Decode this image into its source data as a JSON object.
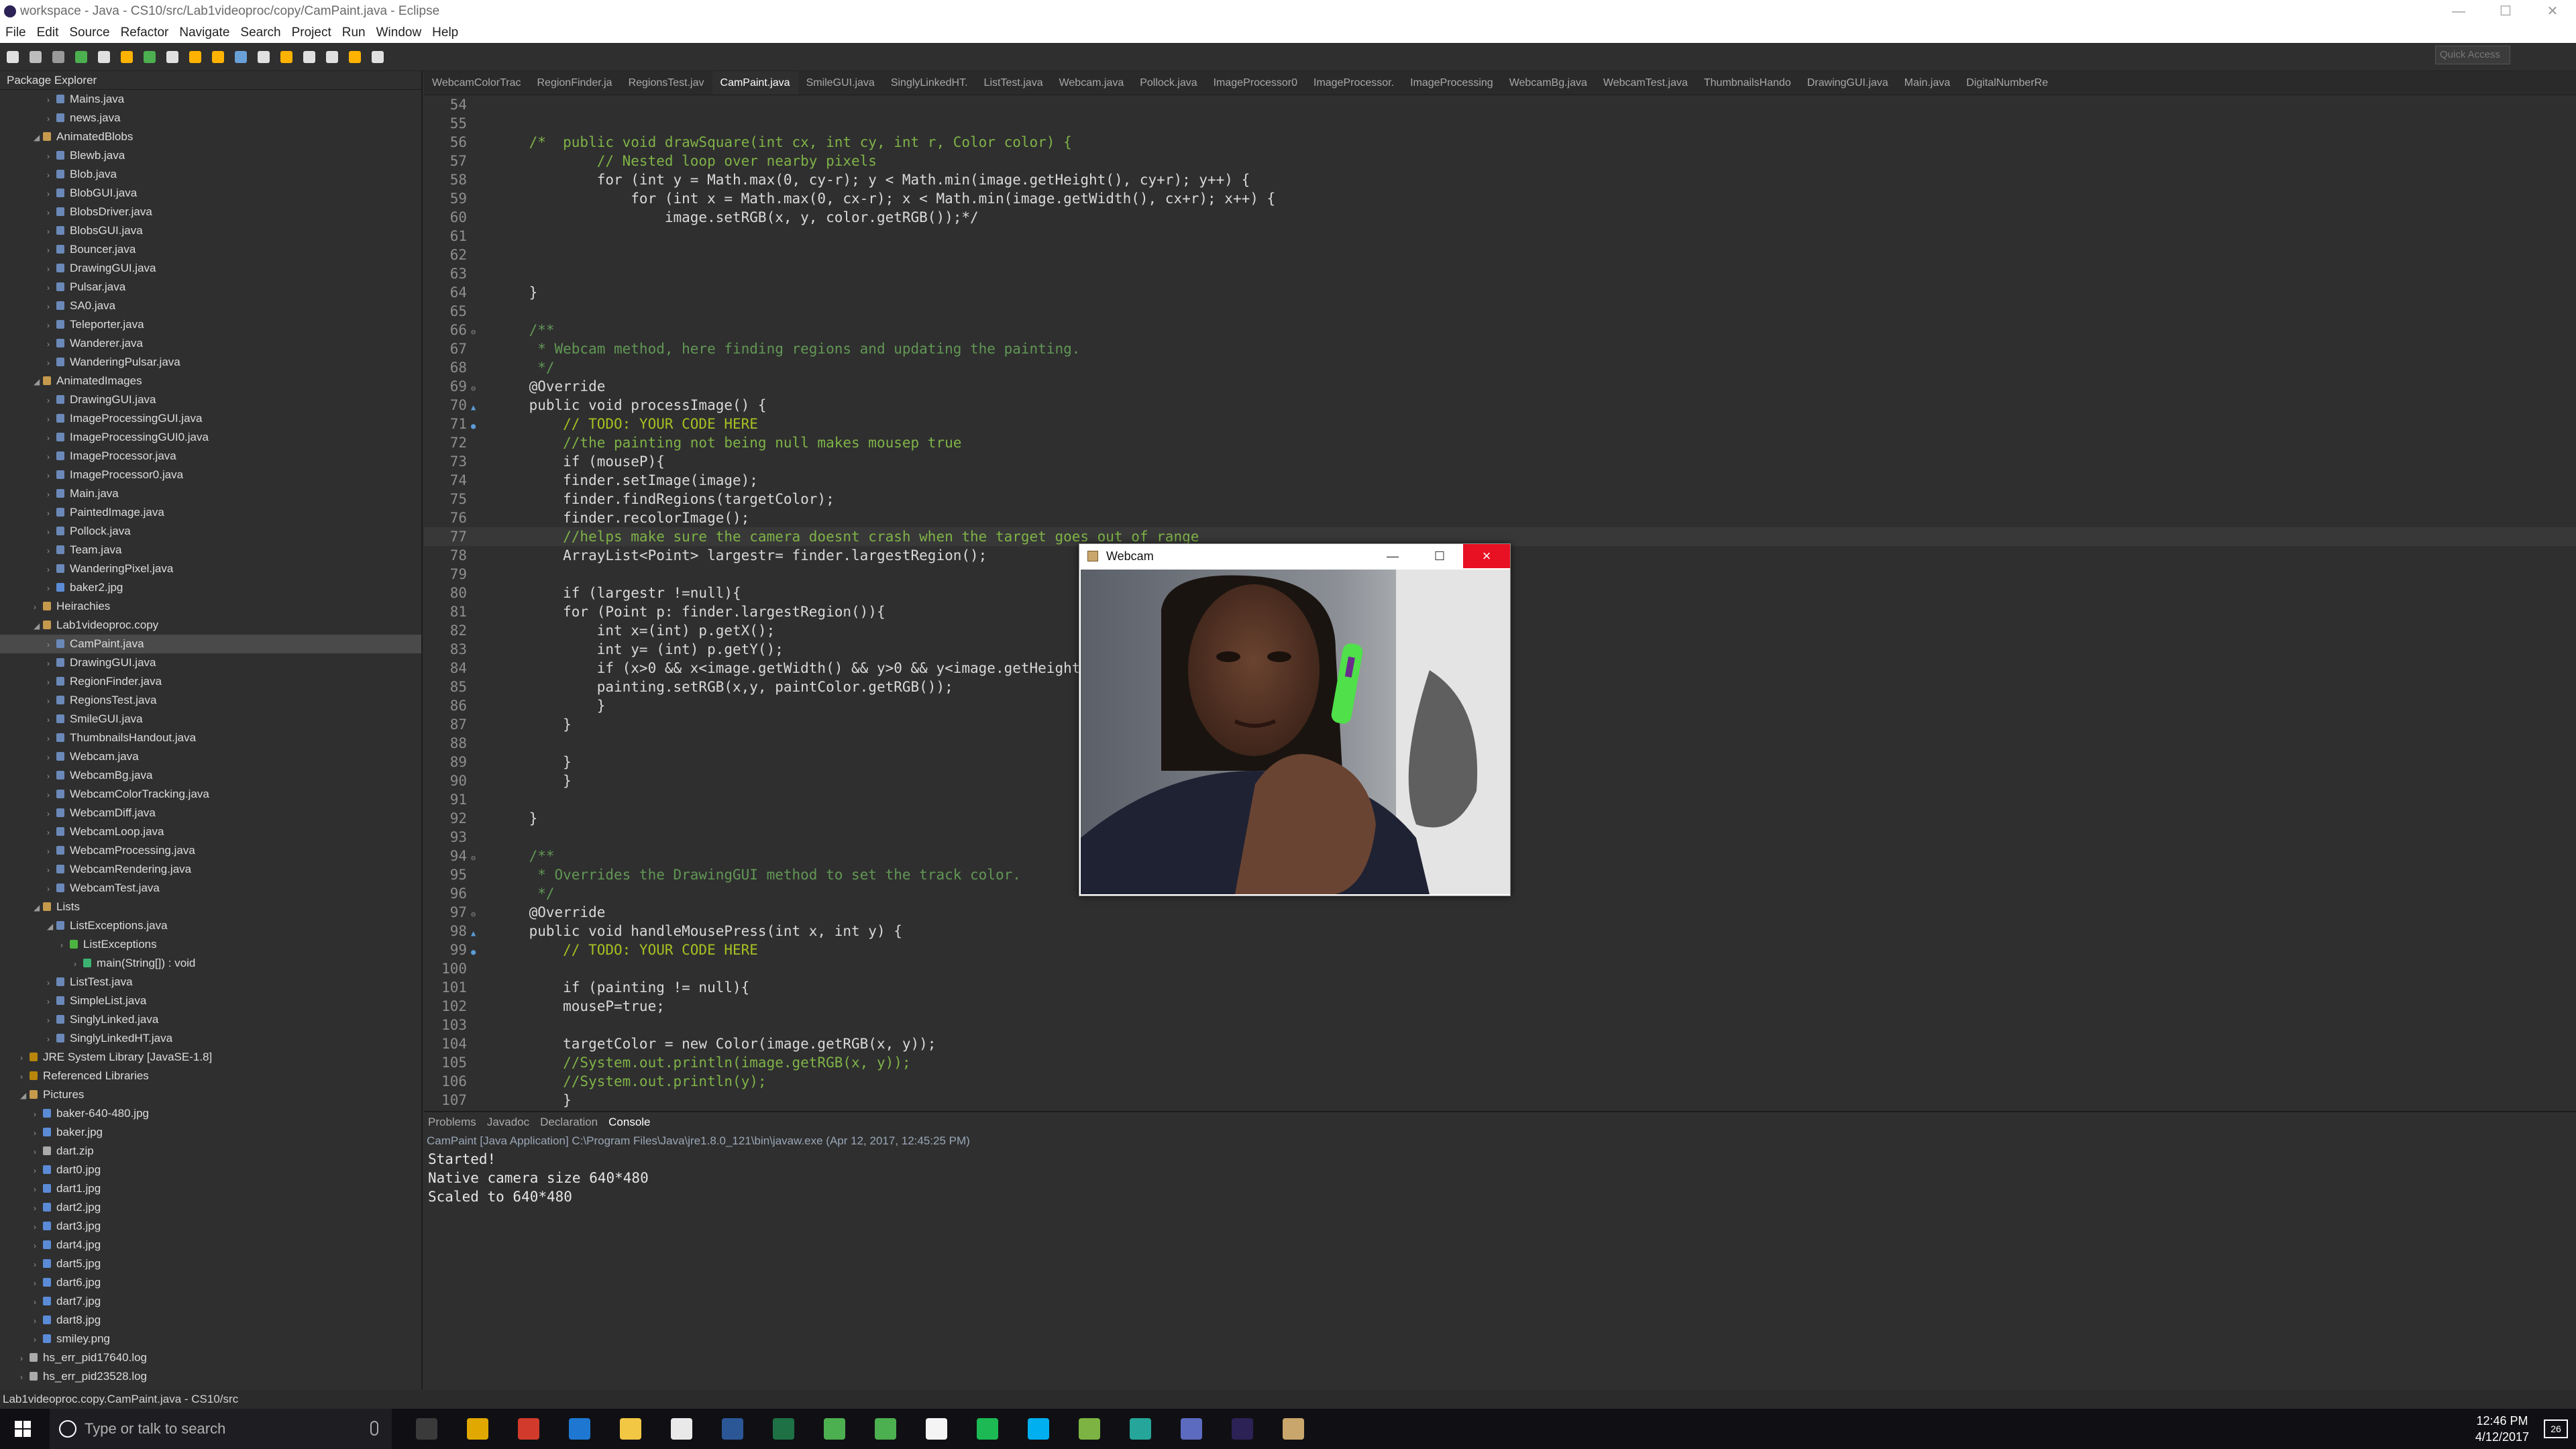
{
  "window": {
    "title": "workspace - Java - CS10/src/Lab1videoproc/copy/CamPaint.java - Eclipse"
  },
  "menu": [
    "File",
    "Edit",
    "Source",
    "Refactor",
    "Navigate",
    "Search",
    "Project",
    "Run",
    "Window",
    "Help"
  ],
  "quick_access": {
    "placeholder": "Quick Access"
  },
  "package_explorer": {
    "title": "Package Explorer",
    "items": [
      {
        "label": "Mains.java",
        "indent": 3,
        "kind": "java"
      },
      {
        "label": "news.java",
        "indent": 3,
        "kind": "java"
      },
      {
        "label": "AnimatedBlobs",
        "indent": 2,
        "kind": "pkg",
        "open": true
      },
      {
        "label": "Blewb.java",
        "indent": 3,
        "kind": "java"
      },
      {
        "label": "Blob.java",
        "indent": 3,
        "kind": "java"
      },
      {
        "label": "BlobGUI.java",
        "indent": 3,
        "kind": "java"
      },
      {
        "label": "BlobsDriver.java",
        "indent": 3,
        "kind": "java"
      },
      {
        "label": "BlobsGUI.java",
        "indent": 3,
        "kind": "java"
      },
      {
        "label": "Bouncer.java",
        "indent": 3,
        "kind": "java"
      },
      {
        "label": "DrawingGUI.java",
        "indent": 3,
        "kind": "java"
      },
      {
        "label": "Pulsar.java",
        "indent": 3,
        "kind": "java"
      },
      {
        "label": "SA0.java",
        "indent": 3,
        "kind": "java"
      },
      {
        "label": "Teleporter.java",
        "indent": 3,
        "kind": "java"
      },
      {
        "label": "Wanderer.java",
        "indent": 3,
        "kind": "java"
      },
      {
        "label": "WanderingPulsar.java",
        "indent": 3,
        "kind": "java"
      },
      {
        "label": "AnimatedImages",
        "indent": 2,
        "kind": "pkg",
        "open": true
      },
      {
        "label": "DrawingGUI.java",
        "indent": 3,
        "kind": "java"
      },
      {
        "label": "ImageProcessingGUI.java",
        "indent": 3,
        "kind": "java"
      },
      {
        "label": "ImageProcessingGUI0.java",
        "indent": 3,
        "kind": "java"
      },
      {
        "label": "ImageProcessor.java",
        "indent": 3,
        "kind": "java"
      },
      {
        "label": "ImageProcessor0.java",
        "indent": 3,
        "kind": "java"
      },
      {
        "label": "Main.java",
        "indent": 3,
        "kind": "java"
      },
      {
        "label": "PaintedImage.java",
        "indent": 3,
        "kind": "java"
      },
      {
        "label": "Pollock.java",
        "indent": 3,
        "kind": "java"
      },
      {
        "label": "Team.java",
        "indent": 3,
        "kind": "java"
      },
      {
        "label": "WanderingPixel.java",
        "indent": 3,
        "kind": "java"
      },
      {
        "label": "baker2.jpg",
        "indent": 3,
        "kind": "img"
      },
      {
        "label": "Heirachies",
        "indent": 2,
        "kind": "pkg-empty"
      },
      {
        "label": "Lab1videoproc.copy",
        "indent": 2,
        "kind": "pkg",
        "open": true
      },
      {
        "label": "CamPaint.java",
        "indent": 3,
        "kind": "java",
        "selected": true
      },
      {
        "label": "DrawingGUI.java",
        "indent": 3,
        "kind": "java"
      },
      {
        "label": "RegionFinder.java",
        "indent": 3,
        "kind": "java"
      },
      {
        "label": "RegionsTest.java",
        "indent": 3,
        "kind": "java"
      },
      {
        "label": "SmileGUI.java",
        "indent": 3,
        "kind": "java"
      },
      {
        "label": "ThumbnailsHandout.java",
        "indent": 3,
        "kind": "java"
      },
      {
        "label": "Webcam.java",
        "indent": 3,
        "kind": "java"
      },
      {
        "label": "WebcamBg.java",
        "indent": 3,
        "kind": "java"
      },
      {
        "label": "WebcamColorTracking.java",
        "indent": 3,
        "kind": "java"
      },
      {
        "label": "WebcamDiff.java",
        "indent": 3,
        "kind": "java"
      },
      {
        "label": "WebcamLoop.java",
        "indent": 3,
        "kind": "java"
      },
      {
        "label": "WebcamProcessing.java",
        "indent": 3,
        "kind": "java"
      },
      {
        "label": "WebcamRendering.java",
        "indent": 3,
        "kind": "java"
      },
      {
        "label": "WebcamTest.java",
        "indent": 3,
        "kind": "java"
      },
      {
        "label": "Lists",
        "indent": 2,
        "kind": "pkg",
        "open": true
      },
      {
        "label": "ListExceptions.java",
        "indent": 3,
        "kind": "java",
        "open": true
      },
      {
        "label": "ListExceptions",
        "indent": 4,
        "kind": "class"
      },
      {
        "label": "main(String[]) : void",
        "indent": 5,
        "kind": "method"
      },
      {
        "label": "ListTest.java",
        "indent": 3,
        "kind": "java"
      },
      {
        "label": "SimpleList.java",
        "indent": 3,
        "kind": "java"
      },
      {
        "label": "SinglyLinked.java",
        "indent": 3,
        "kind": "java"
      },
      {
        "label": "SinglyLinkedHT.java",
        "indent": 3,
        "kind": "java"
      },
      {
        "label": "JRE System Library [JavaSE-1.8]",
        "indent": 1,
        "kind": "lib"
      },
      {
        "label": "Referenced Libraries",
        "indent": 1,
        "kind": "lib"
      },
      {
        "label": "Pictures",
        "indent": 1,
        "kind": "folder",
        "open": true
      },
      {
        "label": "baker-640-480.jpg",
        "indent": 2,
        "kind": "img"
      },
      {
        "label": "baker.jpg",
        "indent": 2,
        "kind": "img"
      },
      {
        "label": "dart.zip",
        "indent": 2,
        "kind": "file"
      },
      {
        "label": "dart0.jpg",
        "indent": 2,
        "kind": "img"
      },
      {
        "label": "dart1.jpg",
        "indent": 2,
        "kind": "img"
      },
      {
        "label": "dart2.jpg",
        "indent": 2,
        "kind": "img"
      },
      {
        "label": "dart3.jpg",
        "indent": 2,
        "kind": "img"
      },
      {
        "label": "dart4.jpg",
        "indent": 2,
        "kind": "img"
      },
      {
        "label": "dart5.jpg",
        "indent": 2,
        "kind": "img"
      },
      {
        "label": "dart6.jpg",
        "indent": 2,
        "kind": "img"
      },
      {
        "label": "dart7.jpg",
        "indent": 2,
        "kind": "img"
      },
      {
        "label": "dart8.jpg",
        "indent": 2,
        "kind": "img"
      },
      {
        "label": "smiley.png",
        "indent": 2,
        "kind": "img"
      },
      {
        "label": "hs_err_pid17640.log",
        "indent": 1,
        "kind": "file"
      },
      {
        "label": "hs_err_pid23528.log",
        "indent": 1,
        "kind": "file"
      }
    ]
  },
  "editor_tabs": [
    {
      "label": "WebcamColorTrac"
    },
    {
      "label": "RegionFinder.ja"
    },
    {
      "label": "RegionsTest.jav"
    },
    {
      "label": "CamPaint.java",
      "active": true
    },
    {
      "label": "SmileGUI.java"
    },
    {
      "label": "SinglyLinkedHT."
    },
    {
      "label": "ListTest.java"
    },
    {
      "label": "Webcam.java"
    },
    {
      "label": "Pollock.java"
    },
    {
      "label": "ImageProcessor0"
    },
    {
      "label": "ImageProcessor."
    },
    {
      "label": "ImageProcessing"
    },
    {
      "label": "WebcamBg.java"
    },
    {
      "label": "WebcamTest.java"
    },
    {
      "label": "ThumbnailsHando"
    },
    {
      "label": "DrawingGUI.java"
    },
    {
      "label": "Main.java"
    },
    {
      "label": "DigitalNumberRe"
    }
  ],
  "code": [
    {
      "n": "54",
      "t": ""
    },
    {
      "n": "55",
      "t": ""
    },
    {
      "n": "56",
      "t": "    /*  public void drawSquare(int cx, int cy, int r, Color color) {"
    },
    {
      "n": "57",
      "t": "            // Nested loop over nearby pixels"
    },
    {
      "n": "58",
      "t": "            for (int y = Math.max(0, cy-r); y < Math.min(image.getHeight(), cy+r); y++) {"
    },
    {
      "n": "59",
      "t": "                for (int x = Math.max(0, cx-r); x < Math.min(image.getWidth(), cx+r); x++) {"
    },
    {
      "n": "60",
      "t": "                    image.setRGB(x, y, color.getRGB());*/"
    },
    {
      "n": "61",
      "t": ""
    },
    {
      "n": "62",
      "t": ""
    },
    {
      "n": "63",
      "t": ""
    },
    {
      "n": "64",
      "t": "    }"
    },
    {
      "n": "65",
      "t": ""
    },
    {
      "n": "66",
      "t": "    /**",
      "mark": "fold"
    },
    {
      "n": "67",
      "t": "     * Webcam method, here finding regions and updating the painting."
    },
    {
      "n": "68",
      "t": "     */"
    },
    {
      "n": "69",
      "t": "    @Override",
      "mark": "fold"
    },
    {
      "n": "70",
      "t": "    public void processImage() {",
      "mark": "override"
    },
    {
      "n": "71",
      "t": "        // TODO: YOUR CODE HERE",
      "mark": "task"
    },
    {
      "n": "72",
      "t": "        //the painting not being null makes mousep true"
    },
    {
      "n": "73",
      "t": "        if (mouseP){"
    },
    {
      "n": "74",
      "t": "        finder.setImage(image);"
    },
    {
      "n": "75",
      "t": "        finder.findRegions(targetColor);"
    },
    {
      "n": "76",
      "t": "        finder.recolorImage();"
    },
    {
      "n": "77",
      "t": "        //helps make sure the camera doesnt crash when the target goes out of range",
      "hl": true
    },
    {
      "n": "78",
      "t": "        ArrayList<Point> largestr= finder.largestRegion();"
    },
    {
      "n": "79",
      "t": ""
    },
    {
      "n": "80",
      "t": "        if (largestr !=null){"
    },
    {
      "n": "81",
      "t": "        for (Point p: finder.largestRegion()){"
    },
    {
      "n": "82",
      "t": "            int x=(int) p.getX();"
    },
    {
      "n": "83",
      "t": "            int y= (int) p.getY();"
    },
    {
      "n": "84",
      "t": "            if (x>0 && x<image.getWidth() && y>0 && y<image.getHeight("
    },
    {
      "n": "85",
      "t": "            painting.setRGB(x,y, paintColor.getRGB());"
    },
    {
      "n": "86",
      "t": "            }"
    },
    {
      "n": "87",
      "t": "        }"
    },
    {
      "n": "88",
      "t": ""
    },
    {
      "n": "89",
      "t": "        }"
    },
    {
      "n": "90",
      "t": "        }"
    },
    {
      "n": "91",
      "t": ""
    },
    {
      "n": "92",
      "t": "    }"
    },
    {
      "n": "93",
      "t": ""
    },
    {
      "n": "94",
      "t": "    /**",
      "mark": "fold"
    },
    {
      "n": "95",
      "t": "     * Overrides the DrawingGUI method to set the track color."
    },
    {
      "n": "96",
      "t": "     */"
    },
    {
      "n": "97",
      "t": "    @Override",
      "mark": "fold"
    },
    {
      "n": "98",
      "t": "    public void handleMousePress(int x, int y) {",
      "mark": "override"
    },
    {
      "n": "99",
      "t": "        // TODO: YOUR CODE HERE",
      "mark": "task"
    },
    {
      "n": "100",
      "t": ""
    },
    {
      "n": "101",
      "t": "        if (painting != null){"
    },
    {
      "n": "102",
      "t": "        mouseP=true;"
    },
    {
      "n": "103",
      "t": ""
    },
    {
      "n": "104",
      "t": "        targetColor = new Color(image.getRGB(x, y));"
    },
    {
      "n": "105",
      "t": "        //System.out.println(image.getRGB(x, y));"
    },
    {
      "n": "106",
      "t": "        //System.out.println(y);"
    },
    {
      "n": "107",
      "t": "        }"
    },
    {
      "n": "108",
      "t": ""
    }
  ],
  "bottom_tabs": [
    "Problems",
    "Javadoc",
    "Declaration",
    "Console"
  ],
  "console": {
    "path": "CamPaint [Java Application] C:\\Program Files\\Java\\jre1.8.0_121\\bin\\javaw.exe (Apr 12, 2017, 12:45:25 PM)",
    "lines": [
      "Started!",
      "Native camera size 640*480",
      "Scaled to 640*480"
    ]
  },
  "status": "Lab1videoproc.copy.CamPaint.java - CS10/src",
  "webcam_window": {
    "title": "Webcam",
    "close": "×",
    "minimize": "—",
    "maximize": "☐"
  },
  "taskbar": {
    "search_placeholder": "Type or talk to search",
    "time": "12:46 PM",
    "date": "4/12/2017",
    "notifications": "26"
  },
  "colors": {
    "keyword": "#cc7832",
    "comment": "#7fb347",
    "javadoc": "#629755",
    "annotation": "#bbb529",
    "todo": "#a8c023",
    "accent": "#e81123"
  }
}
